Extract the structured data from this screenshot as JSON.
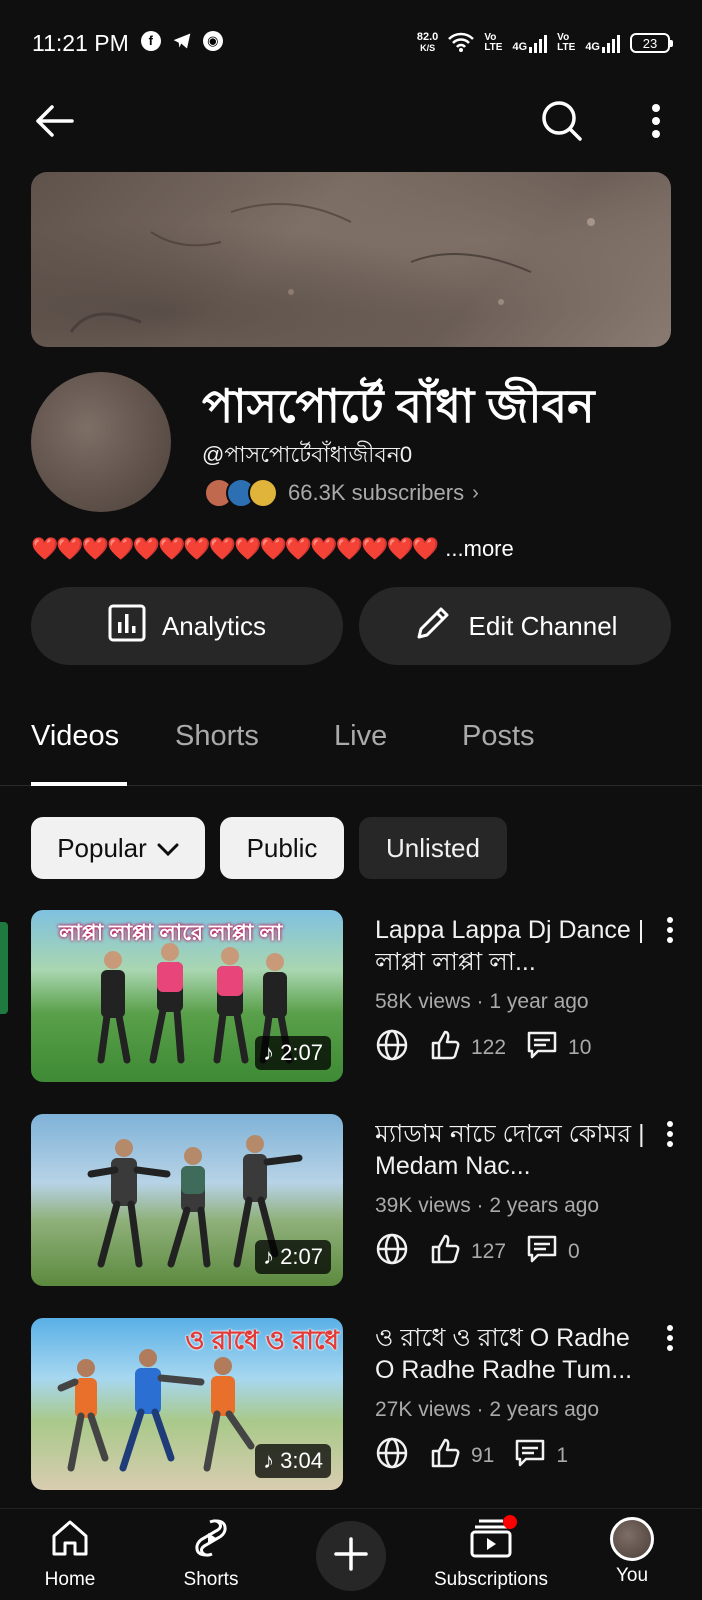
{
  "status_bar": {
    "time": "11:21 PM",
    "net_speed_value": "82.0",
    "net_speed_unit": "K/S",
    "sim1_label_top": "Vo",
    "sim1_label_bottom": "LTE",
    "sim1_net": "4G",
    "sim2_label_top": "Vo",
    "sim2_label_bottom": "LTE",
    "sim2_net": "4G",
    "battery": "23"
  },
  "channel": {
    "name": "পাসপোর্টে বাঁধা জীবন",
    "handle": "@পাসপোর্টেবাঁধাজীবন0",
    "subscribers": "66.3K subscribers",
    "description_hearts": "❤️❤️❤️❤️❤️❤️❤️❤️❤️❤️❤️❤️❤️❤️❤️❤️",
    "more_label": "...more"
  },
  "actions": {
    "analytics_label": "Analytics",
    "edit_label": "Edit Channel"
  },
  "tabs": [
    {
      "label": "Videos",
      "active": true
    },
    {
      "label": "Shorts",
      "active": false
    },
    {
      "label": "Live",
      "active": false
    },
    {
      "label": "Posts",
      "active": false
    }
  ],
  "chips": {
    "popular": "Popular",
    "public": "Public",
    "unlisted": "Unlisted"
  },
  "videos": [
    {
      "title": "Lappa Lappa Dj Dance | লাপ্পা লাপ্পা লা...",
      "meta": "58K views · 1 year ago",
      "likes": "122",
      "comments": "10",
      "duration": "2:07",
      "overlay_text": "লাপ্পা লাপ্পা লারে লাপ্পা লা"
    },
    {
      "title": "ম্যাডাম নাচে দোলে কোমর | Medam Nac...",
      "meta": "39K views · 2 years ago",
      "likes": "127",
      "comments": "0",
      "duration": "2:07",
      "overlay_text": ""
    },
    {
      "title": "ও রাধে ও রাধে O Radhe O Radhe Radhe Tum...",
      "meta": "27K views · 2 years ago",
      "likes": "91",
      "comments": "1",
      "duration": "3:04",
      "overlay_text": "ও রাধে ও রাধে"
    }
  ],
  "bottom_nav": {
    "home": "Home",
    "shorts": "Shorts",
    "subscriptions": "Subscriptions",
    "you": "You"
  },
  "colors": {
    "background": "#0f0f0f",
    "surface": "#272727",
    "text_primary": "#f1f1f1",
    "text_secondary": "#aaaaaa",
    "notification_dot": "#ff0000"
  }
}
